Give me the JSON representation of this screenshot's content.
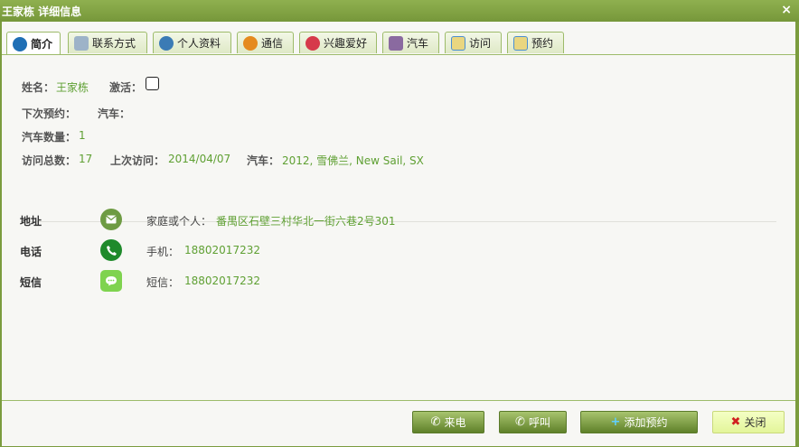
{
  "window": {
    "title": "王家栋 详细信息",
    "close_glyph": "×"
  },
  "tabs": [
    {
      "label": "简介",
      "icon": "info-icon",
      "color": "#1f6fb5"
    },
    {
      "label": "联系方式",
      "icon": "contact-card-icon",
      "color": "#6f8fb0"
    },
    {
      "label": "个人资料",
      "icon": "person-icon",
      "color": "#3b7bb5"
    },
    {
      "label": "通信",
      "icon": "chat-icon",
      "color": "#e58a1f"
    },
    {
      "label": "兴趣爱好",
      "icon": "heart-icon",
      "color": "#d63a4b"
    },
    {
      "label": "汽车",
      "icon": "car-seat-icon",
      "color": "#8a6aa0"
    },
    {
      "label": "访问",
      "icon": "calendar-icon",
      "color": "#4b8fd1"
    },
    {
      "label": "预约",
      "icon": "calendar-icon",
      "color": "#4b8fd1"
    }
  ],
  "profile": {
    "name_label": "姓名：",
    "name_value": "王家栋",
    "active_label": "激活：",
    "next_label": "下次预约：",
    "car_label": "汽车：",
    "car_count_label": "汽车数量：",
    "car_count_value": "1",
    "visits_label": "访问总数：",
    "visits_value": "17",
    "last_visit_label": "上次访问：",
    "last_visit_value": "2014/04/07",
    "car2_label": "汽车：",
    "car2_value": "2012, 雪佛兰, New Sail, SX"
  },
  "contacts": [
    {
      "section": "地址",
      "sub_label": "家庭或个人：",
      "value": "番禺区石壁三村华北一街六巷2号301",
      "icon": "mail-icon",
      "color": "#6e9b43"
    },
    {
      "section": "电话",
      "sub_label": "手机：",
      "value": "18802017232",
      "icon": "phone-icon",
      "color": "#1f8a2b"
    },
    {
      "section": "短信",
      "sub_label": "短信：",
      "value": "18802017232",
      "icon": "sms-icon",
      "color": "#7fd34f"
    }
  ],
  "buttons": {
    "incoming": "来电",
    "call": "呼叫",
    "add_appt": "添加预约",
    "close": "关闭"
  }
}
